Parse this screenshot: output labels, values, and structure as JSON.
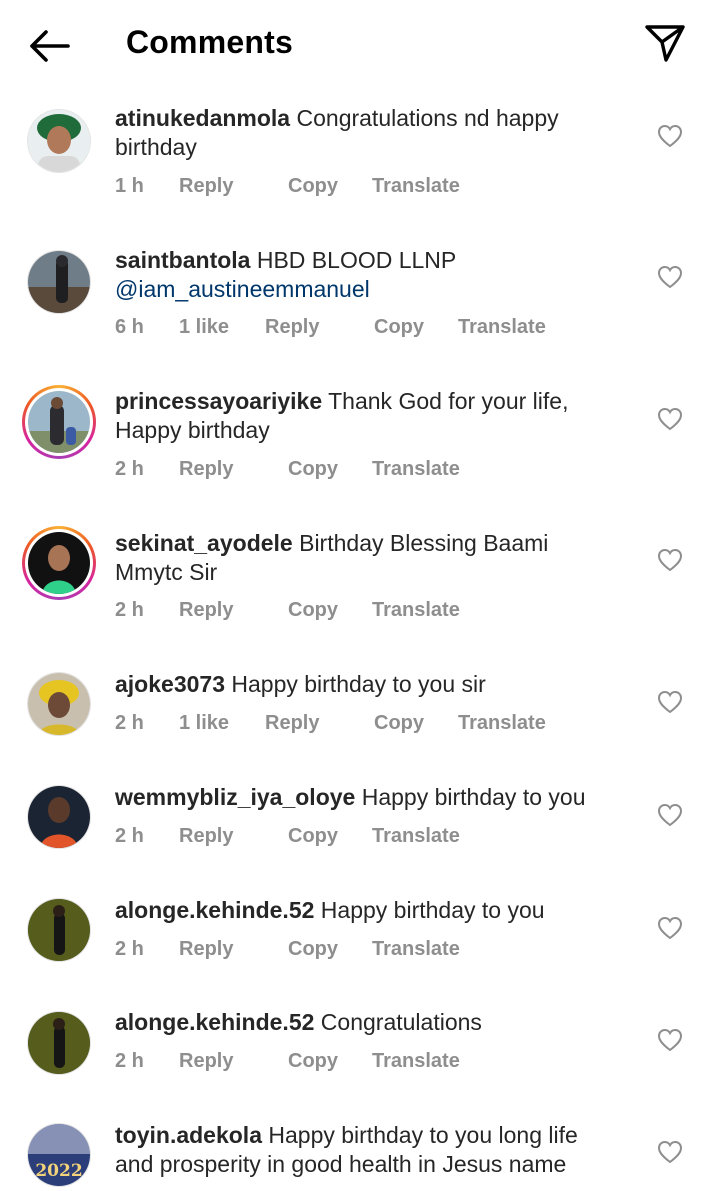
{
  "header": {
    "title": "Comments"
  },
  "actions": {
    "reply": "Reply",
    "copy": "Copy",
    "translate": "Translate"
  },
  "comments": [
    {
      "username": "atinukedanmola",
      "text": "Congratulations nd happy birthday",
      "time": "1 h"
    },
    {
      "username": "saintbantola",
      "text": "HBD BLOOD LLNP",
      "mention": "@iam_austineemmanuel",
      "time": "6 h",
      "likes": "1 like"
    },
    {
      "username": "princessayoariyike",
      "text": "Thank God for your life, Happy birthday",
      "time": "2 h"
    },
    {
      "username": "sekinat_ayodele",
      "text": "Birthday Blessing Baami Mmytc Sir",
      "time": "2 h"
    },
    {
      "username": "ajoke3073",
      "text": "Happy birthday to you sir",
      "time": "2 h",
      "likes": "1 like"
    },
    {
      "username": "wemmybliz_iya_oloye",
      "text": "Happy birthday to you",
      "time": "2 h"
    },
    {
      "username": "alonge.kehinde.52",
      "text": "Happy birthday to you",
      "time": "2 h"
    },
    {
      "username": "alonge.kehinde.52",
      "text": "Congratulations",
      "time": "2 h"
    },
    {
      "username": "toyin.adekola",
      "text": "Happy birthday to you  long life and prosperity in good health in Jesus name",
      "avatar_text": "2022"
    }
  ]
}
